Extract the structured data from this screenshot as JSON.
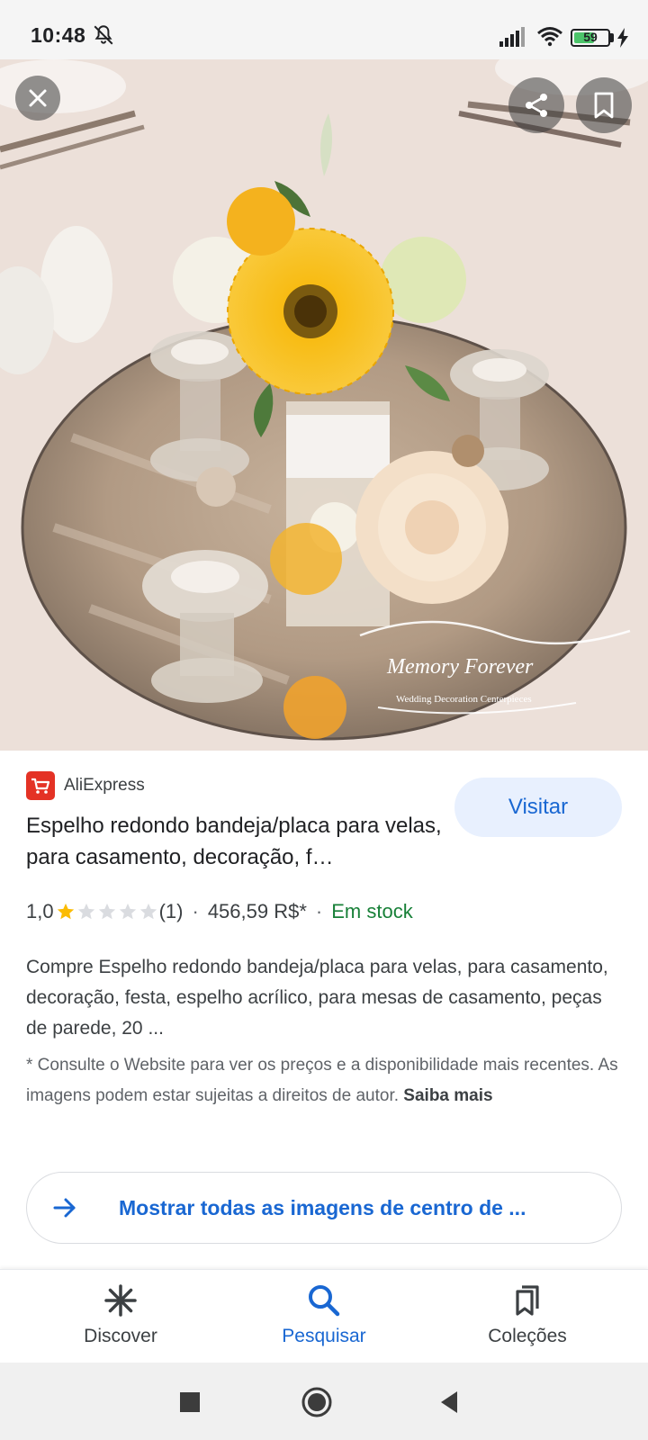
{
  "status_bar": {
    "time": "10:48",
    "battery": "59",
    "icons": [
      "bell-off-icon",
      "signal-icon",
      "wifi-icon",
      "battery-icon",
      "charging-bolt-icon"
    ]
  },
  "image_viewer": {
    "watermark_line1": "Memory Forever",
    "watermark_line2": "Wedding Decoration Centerpieces",
    "close_icon": "close-icon",
    "share_icon": "share-icon",
    "save_icon": "bookmark-icon"
  },
  "result": {
    "source": "AliExpress",
    "title": "Espelho redondo bandeja/placa para velas, para casamento, decoração, f…",
    "visit_label": "Visitar",
    "rating": "1,0",
    "rating_value": 1,
    "rating_max": 5,
    "reviews": "(1)",
    "separator": "·",
    "price": "456,59 R$*",
    "availability": "Em stock",
    "description": "Compre Espelho redondo bandeja/placa para velas, para casamento, decoração, festa, espelho acrílico, para mesas de casamento, peças de parede, 20 ...",
    "disclaimer": "* Consulte o Website para ver os preços e a disponibilidade mais recentes. As imagens podem estar sujeitas a direitos de autor.",
    "learn_more": "Saiba mais",
    "more_images_label": "Mostrar todas as imagens de centro de ..."
  },
  "bottom_nav": {
    "items": [
      {
        "label": "Discover",
        "icon": "asterisk-icon",
        "active": false
      },
      {
        "label": "Pesquisar",
        "icon": "search-icon",
        "active": true
      },
      {
        "label": "Coleções",
        "icon": "collections-icon",
        "active": false
      }
    ]
  },
  "colors": {
    "accent": "#1967d2",
    "stock_green": "#188038",
    "star_gold": "#fbbc04",
    "visit_bg": "#e8f0fe"
  }
}
